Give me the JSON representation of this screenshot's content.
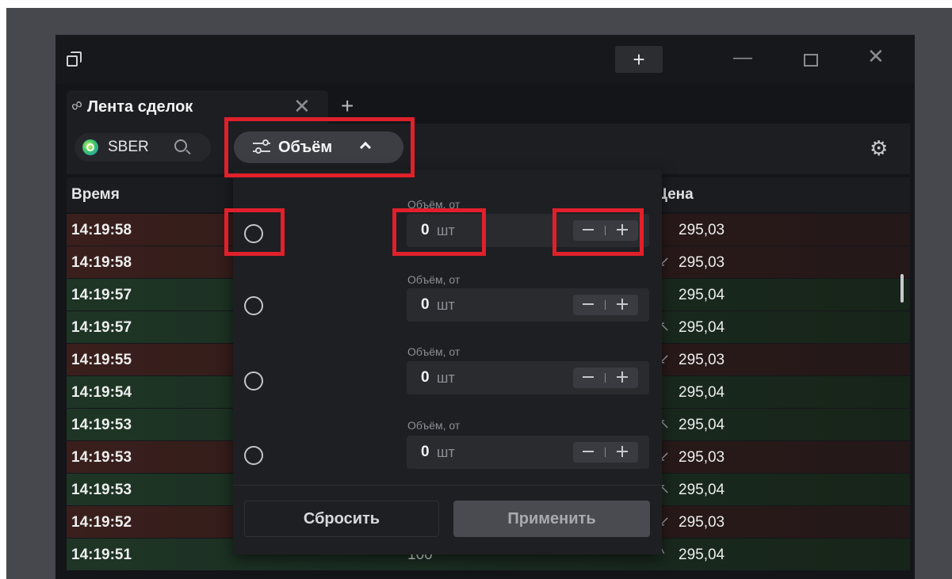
{
  "window": {
    "titlebar_add_label": "+",
    "minimize_label": "—",
    "close_label": "✕"
  },
  "tab": {
    "title": "Лента сделок",
    "close_label": "✕",
    "add_label": "+"
  },
  "toolbar": {
    "ticker": "SBER",
    "filter_label": "Объём"
  },
  "table": {
    "headers": {
      "time": "Время",
      "price": "Цена"
    },
    "rows": [
      {
        "time": "14:19:58",
        "side": "sell",
        "volume": "",
        "arrow": "",
        "price": "295,03"
      },
      {
        "time": "14:19:58",
        "side": "sell",
        "volume": "",
        "arrow": "↙",
        "price": "295,03"
      },
      {
        "time": "14:19:57",
        "side": "buy",
        "volume": "",
        "arrow": "",
        "price": "295,04"
      },
      {
        "time": "14:19:57",
        "side": "buy",
        "volume": "",
        "arrow": "↖",
        "price": "295,04"
      },
      {
        "time": "14:19:55",
        "side": "sell",
        "volume": "",
        "arrow": "↙",
        "price": "295,03"
      },
      {
        "time": "14:19:54",
        "side": "buy",
        "volume": "",
        "arrow": "",
        "price": "295,04"
      },
      {
        "time": "14:19:53",
        "side": "buy",
        "volume": "",
        "arrow": "↖",
        "price": "295,04"
      },
      {
        "time": "14:19:53",
        "side": "sell",
        "volume": "",
        "arrow": "↙",
        "price": "295,03"
      },
      {
        "time": "14:19:53",
        "side": "buy",
        "volume": "",
        "arrow": "↖",
        "price": "295,04"
      },
      {
        "time": "14:19:52",
        "side": "sell",
        "volume": "",
        "arrow": "↙",
        "price": "295,03"
      },
      {
        "time": "14:19:51",
        "side": "buy",
        "volume": "100",
        "arrow": "^",
        "price": "295,04"
      }
    ]
  },
  "volume_filter": {
    "rows": [
      {
        "label": "Объём, от",
        "value": "0",
        "unit": "шт"
      },
      {
        "label": "Объём, от",
        "value": "0",
        "unit": "шт"
      },
      {
        "label": "Объём, от",
        "value": "0",
        "unit": "шт"
      },
      {
        "label": "Объём, от",
        "value": "0",
        "unit": "шт"
      }
    ],
    "reset_label": "Сбросить",
    "apply_label": "Применить"
  },
  "colors": {
    "highlight": "#e0202b",
    "sell_row": "#3a1f1c",
    "buy_row": "#1e3525"
  }
}
